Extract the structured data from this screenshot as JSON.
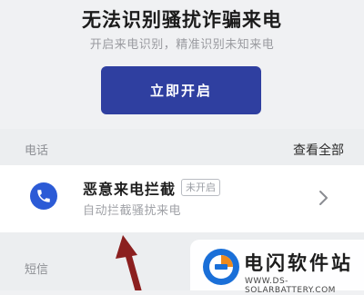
{
  "hero": {
    "title": "无法识别骚扰诈骗来电",
    "subtitle": "开启来电识别，精准识别未知来电",
    "enable_button": "立即开启"
  },
  "calls_section": {
    "label": "电话",
    "view_all": "查看全部",
    "item": {
      "icon": "phone-icon",
      "title": "恶意来电拦截",
      "badge": "未开启",
      "description": "自动拦截骚扰来电"
    }
  },
  "sms_section": {
    "label": "短信"
  },
  "watermark": {
    "name": "电闪软件站",
    "url": "WWW.DS-SOLARBATTERY.COM"
  },
  "colors": {
    "accent": "#2f3fa0",
    "icon_blue": "#2c5bd6",
    "annotation_arrow": "#8b1f1f",
    "background": "#f0f1f3"
  }
}
